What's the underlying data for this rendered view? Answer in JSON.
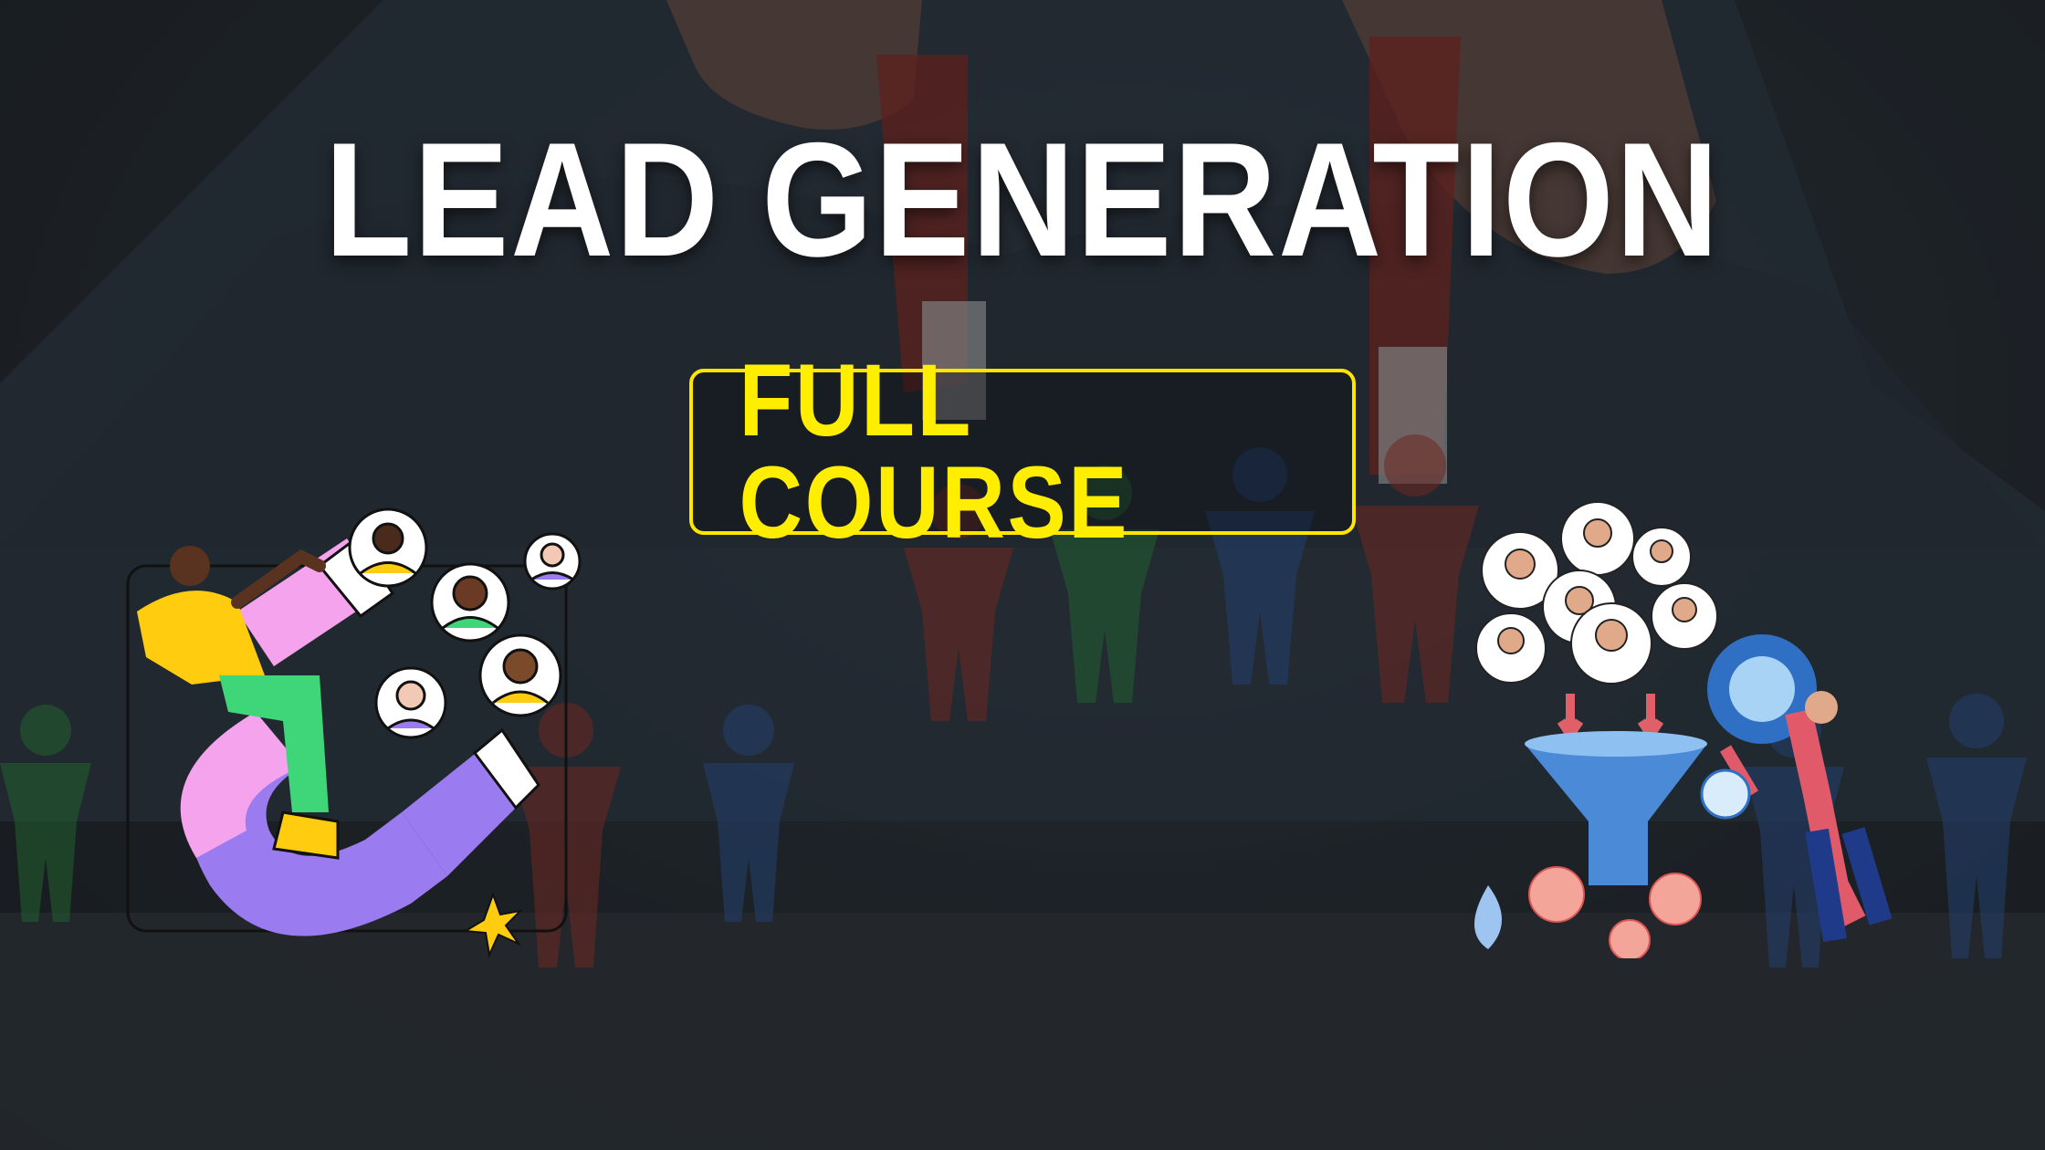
{
  "title": "LEAD GENERATION",
  "badge": "FULL COURSE",
  "icons": {
    "left_illustration": "magnet-people-icon",
    "right_illustration": "sales-funnel-icon"
  },
  "colors": {
    "title": "#ffffff",
    "badge_text": "#ffee00",
    "badge_border": "#ffe600",
    "background": "#262c33"
  }
}
